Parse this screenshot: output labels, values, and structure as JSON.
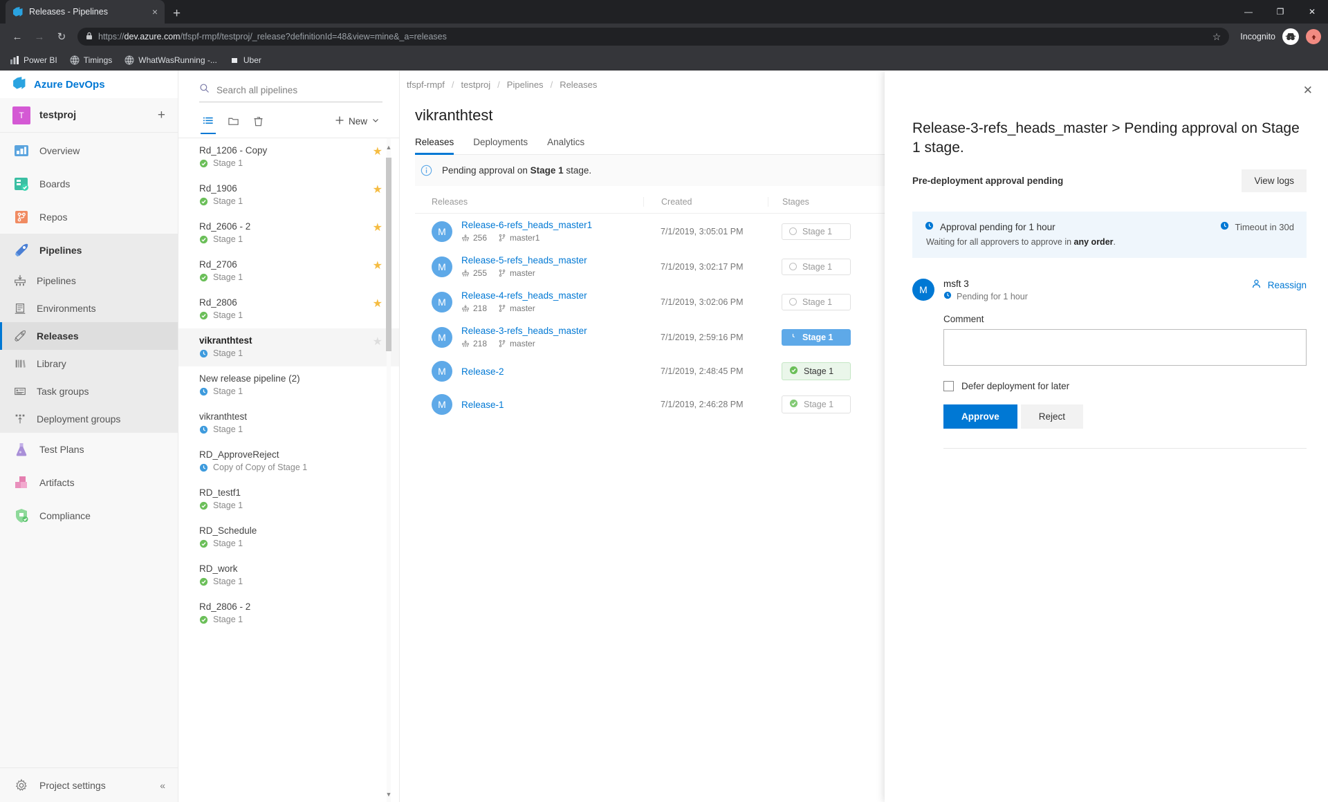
{
  "browser": {
    "tab_title": "Releases - Pipelines",
    "tab_favicon": "azure-devops-icon",
    "new_tab_label": "+",
    "close_tab_label": "×",
    "minimize_label": "—",
    "maximize_label": "❐",
    "close_label": "✕",
    "back_label": "←",
    "forward_label": "→",
    "reload_label": "↻",
    "url_scheme": "https://",
    "url_host": "dev.azure.com",
    "url_path": "/tfspf-rmpf/testproj/_release?definitionId=48&view=mine&_a=releases",
    "star_label": "☆",
    "incognito_label": "Incognito",
    "bookmarks": [
      {
        "label": "Power BI",
        "icon": "powerbi-icon"
      },
      {
        "label": "Timings",
        "icon": "globe-icon"
      },
      {
        "label": "WhatWasRunning -...",
        "icon": "globe-icon"
      },
      {
        "label": "Uber",
        "icon": "square-icon"
      }
    ]
  },
  "rail": {
    "logo_text": "Azure DevOps",
    "project_initial": "T",
    "project_name": "testproj",
    "add_label": "+",
    "items": [
      {
        "label": "Overview",
        "icon": "overview-icon",
        "level": "top",
        "state": "normal"
      },
      {
        "label": "Boards",
        "icon": "boards-icon",
        "level": "top",
        "state": "normal"
      },
      {
        "label": "Repos",
        "icon": "repos-icon",
        "level": "top",
        "state": "normal"
      },
      {
        "label": "Pipelines",
        "icon": "pipelines-icon",
        "level": "top",
        "state": "group"
      },
      {
        "label": "Pipelines",
        "icon": "pipelines-sub-icon",
        "level": "sub",
        "state": "group"
      },
      {
        "label": "Environments",
        "icon": "environments-icon",
        "level": "sub",
        "state": "group"
      },
      {
        "label": "Releases",
        "icon": "releases-icon",
        "level": "sub",
        "state": "active"
      },
      {
        "label": "Library",
        "icon": "library-icon",
        "level": "sub",
        "state": "group"
      },
      {
        "label": "Task groups",
        "icon": "taskgroups-icon",
        "level": "sub",
        "state": "group"
      },
      {
        "label": "Deployment groups",
        "icon": "deploymentgroups-icon",
        "level": "sub",
        "state": "group"
      },
      {
        "label": "Test Plans",
        "icon": "testplans-icon",
        "level": "top",
        "state": "normal"
      },
      {
        "label": "Artifacts",
        "icon": "artifacts-icon",
        "level": "top",
        "state": "normal"
      },
      {
        "label": "Compliance",
        "icon": "compliance-icon",
        "level": "top",
        "state": "normal"
      }
    ],
    "project_settings": "Project settings",
    "collapse_label": "«"
  },
  "pipelines_panel": {
    "search_placeholder": "Search all pipelines",
    "search_value": "",
    "tools": [
      {
        "name": "list-view-icon",
        "selected": true
      },
      {
        "name": "folder-icon",
        "selected": false
      },
      {
        "name": "trash-icon",
        "selected": false
      }
    ],
    "new_label": "New",
    "items": [
      {
        "title": "Rd_1206 - Copy",
        "stage": "Stage 1",
        "status": "succeeded",
        "starred": true,
        "selected": false
      },
      {
        "title": "Rd_1906",
        "stage": "Stage 1",
        "status": "succeeded",
        "starred": true,
        "selected": false
      },
      {
        "title": "Rd_2606 - 2",
        "stage": "Stage 1",
        "status": "succeeded",
        "starred": true,
        "selected": false
      },
      {
        "title": "Rd_2706",
        "stage": "Stage 1",
        "status": "succeeded",
        "starred": true,
        "selected": false
      },
      {
        "title": "Rd_2806",
        "stage": "Stage 1",
        "status": "succeeded",
        "starred": true,
        "selected": false
      },
      {
        "title": "vikranthtest",
        "stage": "Stage 1",
        "status": "pending",
        "starred": false,
        "selected": true
      },
      {
        "title": "New release pipeline (2)",
        "stage": "Stage 1",
        "status": "pending",
        "starred": false,
        "selected": false
      },
      {
        "title": "vikranthtest",
        "stage": "Stage 1",
        "status": "pending",
        "starred": false,
        "selected": false
      },
      {
        "title": "RD_ApproveReject",
        "stage": "Copy of Copy of Stage 1",
        "status": "pending",
        "starred": false,
        "selected": false
      },
      {
        "title": "RD_testf1",
        "stage": "Stage 1",
        "status": "succeeded",
        "starred": false,
        "selected": false
      },
      {
        "title": "RD_Schedule",
        "stage": "Stage 1",
        "status": "succeeded",
        "starred": false,
        "selected": false
      },
      {
        "title": "RD_work",
        "stage": "Stage 1",
        "status": "succeeded",
        "starred": false,
        "selected": false
      },
      {
        "title": "Rd_2806 - 2",
        "stage": "Stage 1",
        "status": "succeeded",
        "starred": false,
        "selected": false
      }
    ]
  },
  "breadcrumb": [
    "tfspf-rmpf",
    "testproj",
    "Pipelines",
    "Releases"
  ],
  "main": {
    "page_title": "vikranthtest",
    "tabs": [
      {
        "label": "Releases",
        "active": true
      },
      {
        "label": "Deployments",
        "active": false
      },
      {
        "label": "Analytics",
        "active": false
      }
    ],
    "banner_text_prefix": "Pending approval on ",
    "banner_text_bold": "Stage 1",
    "banner_text_suffix": " stage.",
    "columns": {
      "releases": "Releases",
      "created": "Created",
      "stages": "Stages"
    },
    "rows": [
      {
        "avatar": "M",
        "name": "Release-6-refs_heads_master1",
        "build": "256",
        "branch": "master1",
        "created": "7/1/2019, 3:05:01 PM",
        "stage": "Stage 1",
        "stage_state": "notstarted"
      },
      {
        "avatar": "M",
        "name": "Release-5-refs_heads_master",
        "build": "255",
        "branch": "master",
        "created": "7/1/2019, 3:02:17 PM",
        "stage": "Stage 1",
        "stage_state": "notstarted"
      },
      {
        "avatar": "M",
        "name": "Release-4-refs_heads_master",
        "build": "218",
        "branch": "master",
        "created": "7/1/2019, 3:02:06 PM",
        "stage": "Stage 1",
        "stage_state": "notstarted"
      },
      {
        "avatar": "M",
        "name": "Release-3-refs_heads_master",
        "build": "218",
        "branch": "master",
        "created": "7/1/2019, 2:59:16 PM",
        "stage": "Stage 1",
        "stage_state": "inprogress"
      },
      {
        "avatar": "M",
        "name": "Release-2",
        "build": "",
        "branch": "",
        "created": "7/1/2019, 2:48:45 PM",
        "stage": "Stage 1",
        "stage_state": "succeeded-hl"
      },
      {
        "avatar": "M",
        "name": "Release-1",
        "build": "",
        "branch": "",
        "created": "7/1/2019, 2:46:28 PM",
        "stage": "Stage 1",
        "stage_state": "succeeded"
      }
    ]
  },
  "panel": {
    "close_label": "✕",
    "title": "Release-3-refs_heads_master > Pending approval on Stage 1 stage.",
    "subtitle": "Pre-deployment approval pending",
    "view_logs_label": "View logs",
    "approval_pending_text": "Approval pending for 1 hour",
    "timeout_text": "Timeout in 30d",
    "waiting_prefix": "Waiting for all approvers to approve in ",
    "waiting_bold": "any order",
    "waiting_suffix": ".",
    "approver_initial": "M",
    "approver_name": "msft 3",
    "approver_pending": "Pending for 1 hour",
    "reassign_label": "Reassign",
    "comment_label": "Comment",
    "comment_value": "",
    "comment_placeholder": "",
    "defer_label": "Defer deployment for later",
    "defer_checked": false,
    "approve_label": "Approve",
    "reject_label": "Reject"
  },
  "colors": {
    "accent": "#0078d4",
    "inprogress": "#5ea9e8",
    "success": "#6bb700",
    "success_bg": "#eaf6ea",
    "info_bg": "#eff6fc",
    "star": "#f5bc42"
  }
}
